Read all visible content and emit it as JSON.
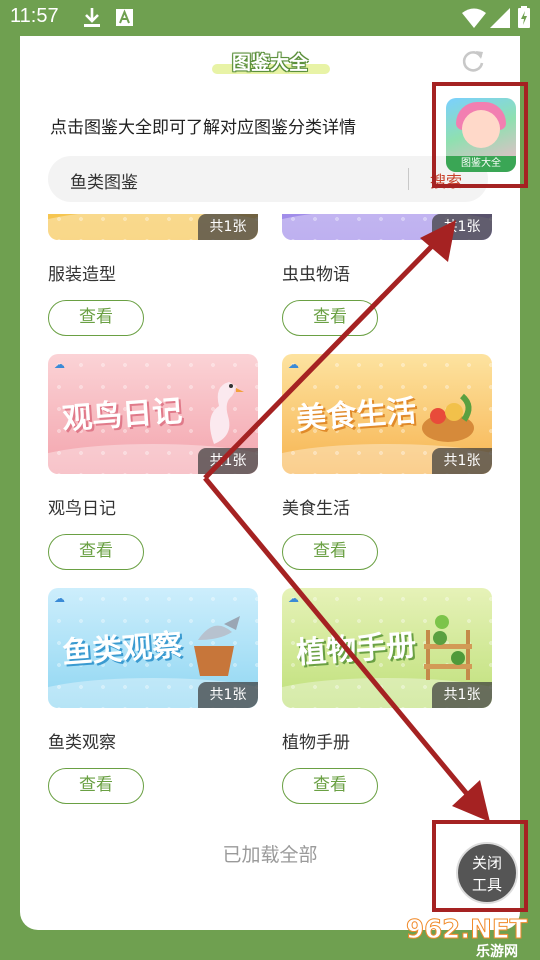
{
  "status": {
    "time": "11:57",
    "download_icon": "download-icon",
    "a_icon": "a-notification-icon",
    "wifi_icon": "wifi-icon",
    "signal_icon": "signal-icon",
    "battery_icon": "battery-charging-icon"
  },
  "header": {
    "title": "图鉴大全",
    "refresh_icon": "refresh-icon"
  },
  "hint": "点击图鉴大全即可了解对应图鉴分类详情",
  "app_icon": {
    "caption": "图鉴大全"
  },
  "search": {
    "value": "鱼类图鉴",
    "button_label": "搜索"
  },
  "items": [
    {
      "name": "服装造型",
      "count": "共1张",
      "view": "查看",
      "color_top": "#f5d36a",
      "color_bottom": "#f6c24a",
      "banner": ""
    },
    {
      "name": "虫虫物语",
      "count": "共1张",
      "view": "查看",
      "color_top": "#b9a9f2",
      "color_bottom": "#9b86e8",
      "banner": ""
    },
    {
      "name": "观鸟日记",
      "count": "共1张",
      "view": "查看",
      "color_top": "#fbd3d6",
      "color_bottom": "#f3a4ad",
      "banner": "观鸟日记"
    },
    {
      "name": "美食生活",
      "count": "共1张",
      "view": "查看",
      "color_top": "#fde3a0",
      "color_bottom": "#f7b451",
      "banner": "美食生活"
    },
    {
      "name": "鱼类观察",
      "count": "共1张",
      "view": "查看",
      "color_top": "#cdeefc",
      "color_bottom": "#8fd6f2",
      "banner": "鱼类观察"
    },
    {
      "name": "植物手册",
      "count": "共1张",
      "view": "查看",
      "color_top": "#e6f2b8",
      "color_bottom": "#bfe07a",
      "banner": "植物手册"
    }
  ],
  "footer_text": "已加载全部",
  "close_button": {
    "line1": "关闭",
    "line2": "工具"
  },
  "watermark": {
    "top": "962.NET",
    "bottom": "乐游网"
  },
  "colors": {
    "background": "#6fa050",
    "accent_green": "#6aa043",
    "annotation_red": "#a52222",
    "search_red": "#c8402a"
  }
}
